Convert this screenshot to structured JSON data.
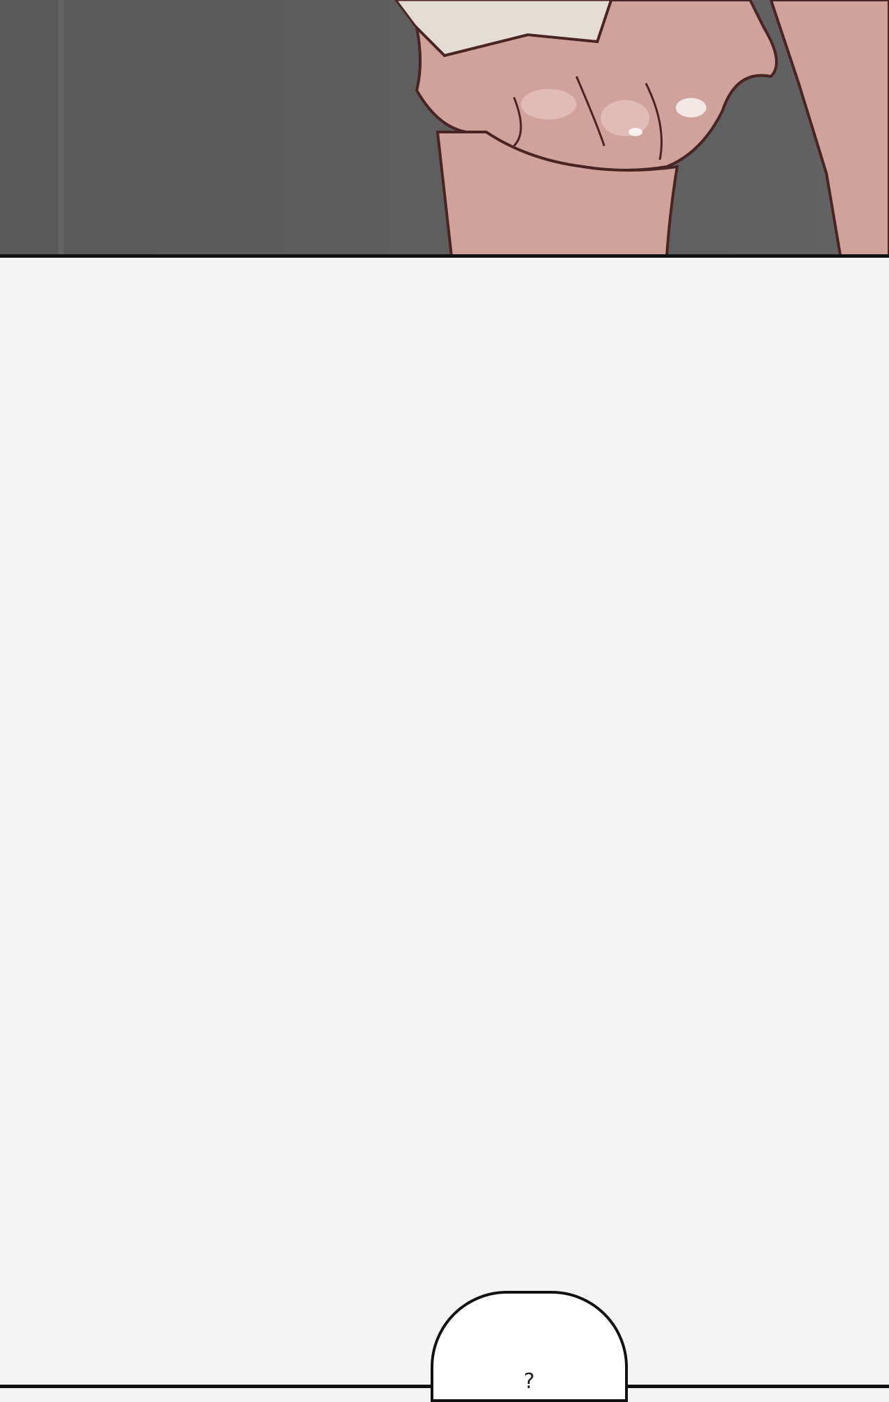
{
  "panel_illustration": {
    "subject": "hand-icon",
    "palette": {
      "background": "#5e5e5e",
      "skin": "#cfa39b",
      "outline": "#4a2323",
      "sleeve": "#e4ddd5"
    }
  },
  "speech_bubble": {
    "text": "?"
  }
}
